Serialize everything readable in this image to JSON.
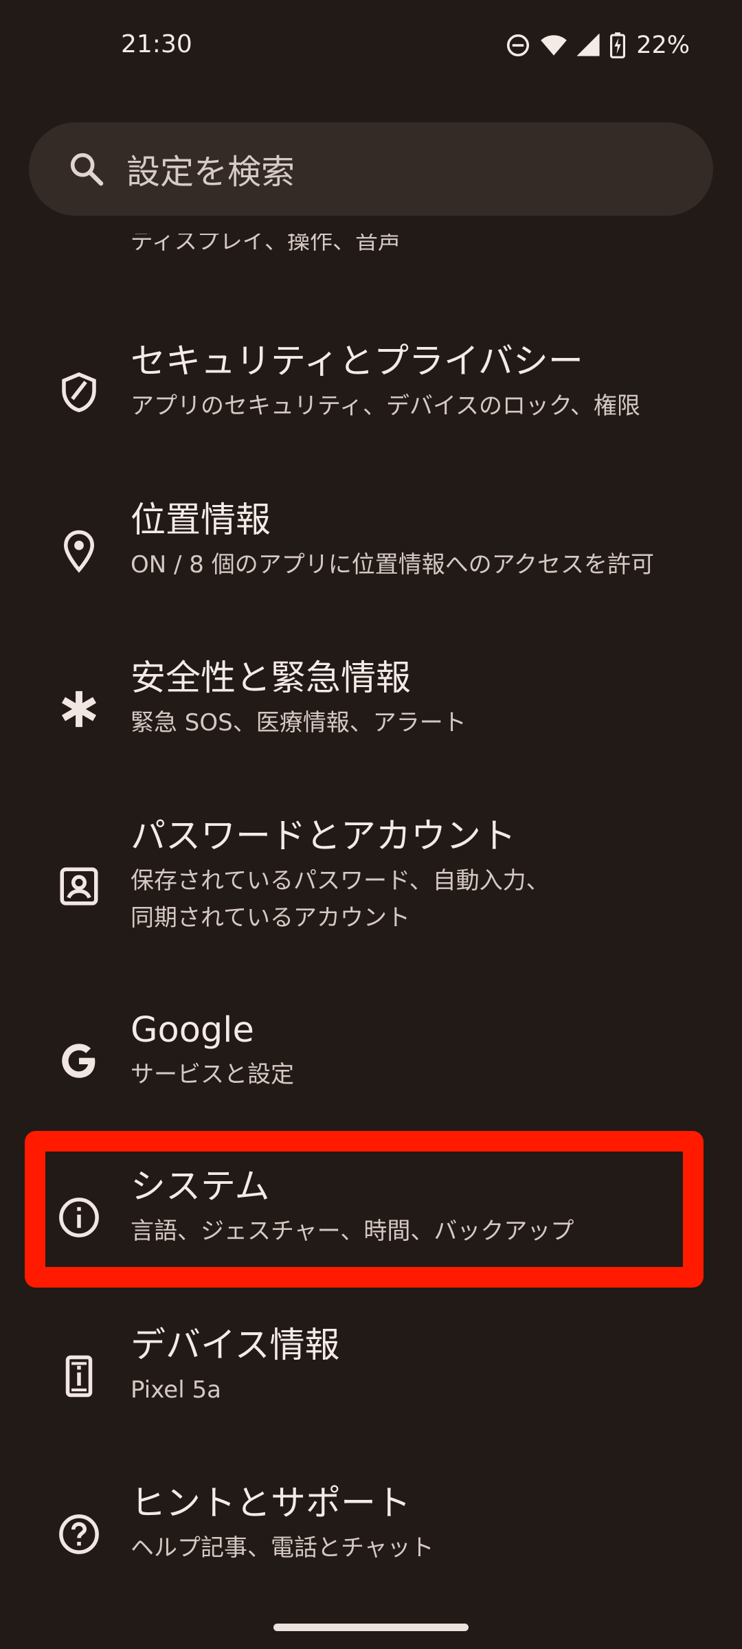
{
  "status_bar": {
    "time": "21:30",
    "battery": "22%",
    "icons": [
      "do-not-disturb-icon",
      "wifi-icon",
      "cell-signal-icon",
      "battery-charging-icon"
    ]
  },
  "search": {
    "placeholder": "設定を検索"
  },
  "partial_item": {
    "subtitle": "ディスプレイ、操作、音声"
  },
  "items": [
    {
      "icon": "shield-icon",
      "title": "セキュリティとプライバシー",
      "subtitle": "アプリのセキュリティ、デバイスのロック、権限"
    },
    {
      "icon": "location-pin-icon",
      "title": "位置情報",
      "subtitle": "ON / 8 個のアプリに位置情報へのアクセスを許可"
    },
    {
      "icon": "asterisk-icon",
      "title": "安全性と緊急情報",
      "subtitle": "緊急 SOS、医療情報、アラート"
    },
    {
      "icon": "account-box-icon",
      "title": "パスワードとアカウント",
      "subtitle_line1": "保存されているパスワード、自動入力、",
      "subtitle_line2": "同期されているアカウント"
    },
    {
      "icon": "google-icon",
      "title": "Google",
      "subtitle": "サービスと設定"
    },
    {
      "icon": "info-icon",
      "title": "システム",
      "subtitle": "言語、ジェスチャー、時間、バックアップ"
    },
    {
      "icon": "phone-info-icon",
      "title": "デバイス情報",
      "subtitle": "Pixel 5a"
    },
    {
      "icon": "help-icon",
      "title": "ヒントとサポート",
      "subtitle": "ヘルプ記事、電話とチャット"
    }
  ],
  "colors": {
    "background": "#221a17",
    "highlight": "#ff1a00"
  }
}
